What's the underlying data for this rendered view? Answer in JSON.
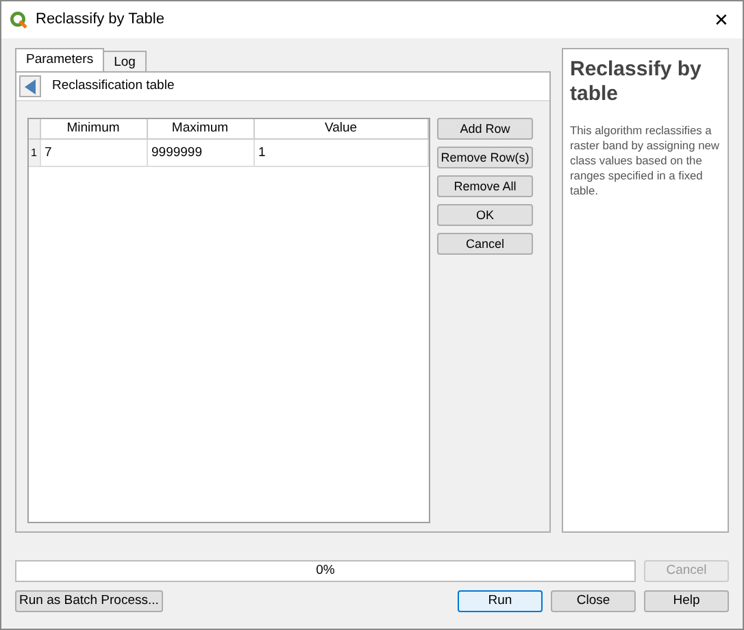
{
  "window": {
    "title": "Reclassify by Table",
    "close": "✕"
  },
  "tabs": [
    {
      "label": "Parameters",
      "selected": true
    },
    {
      "label": "Log",
      "selected": false
    }
  ],
  "panel": {
    "title": "Reclassification table"
  },
  "table": {
    "columns": [
      "Minimum",
      "Maximum",
      "Value"
    ],
    "rows": [
      {
        "number": "1",
        "cells": [
          "7",
          "9999999",
          "1"
        ]
      }
    ]
  },
  "table_buttons": [
    "Add Row",
    "Remove Row(s)",
    "Remove All",
    "OK",
    "Cancel"
  ],
  "help": {
    "title": "Reclassify by table",
    "text": "This algorithm reclassifies a raster band by assigning new class values based on the ranges specified in a fixed table."
  },
  "progress": {
    "text": "0%",
    "level": 0
  },
  "cancel_button": {
    "label": "Cancel",
    "disabled": true
  },
  "batch_button": "Run as Batch Process...",
  "buttons": [
    {
      "label": "Run",
      "default": true
    },
    {
      "label": "Close",
      "default": false
    },
    {
      "label": "Help",
      "default": false
    }
  ]
}
